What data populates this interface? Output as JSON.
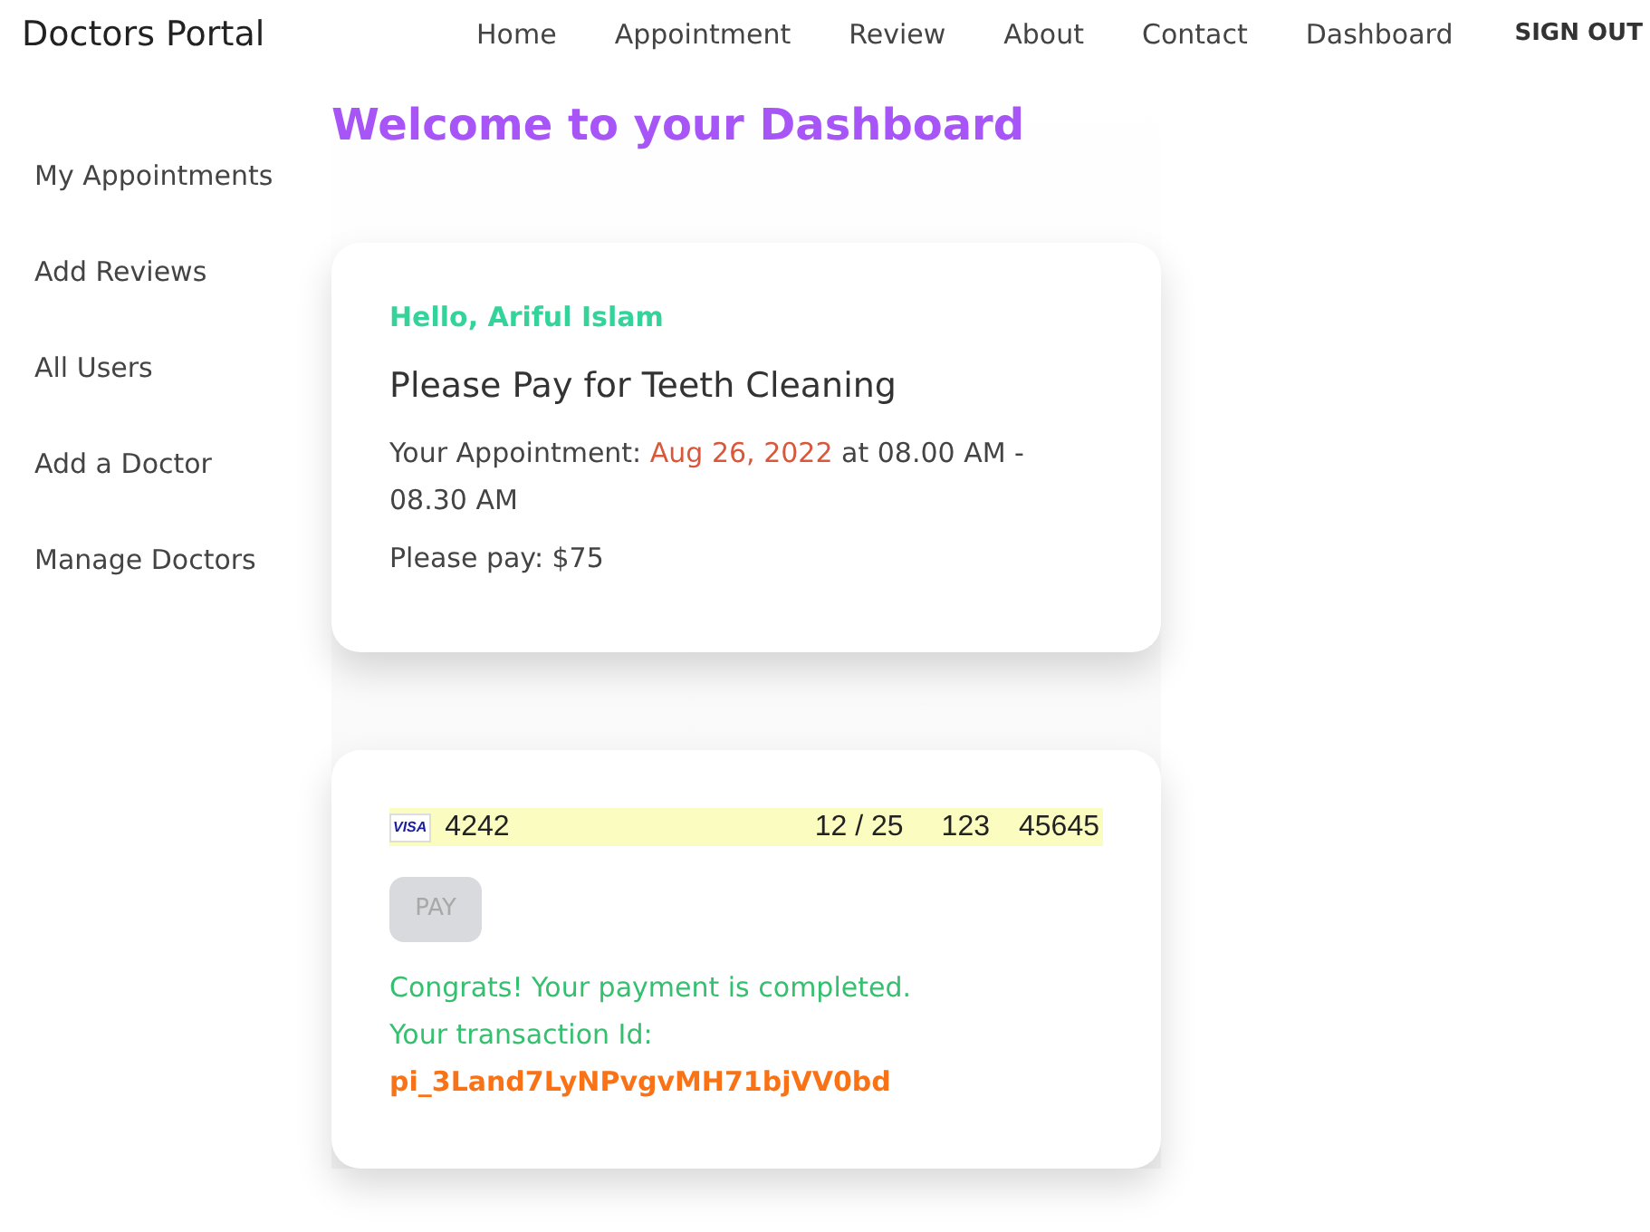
{
  "navbar": {
    "brand": "Doctors Portal",
    "links": [
      "Home",
      "Appointment",
      "Review",
      "About",
      "Contact",
      "Dashboard"
    ],
    "sign_out": "SIGN OUT"
  },
  "sidebar": {
    "items": [
      "My Appointments",
      "Add Reviews",
      "All Users",
      "Add a Doctor",
      "Manage Doctors"
    ]
  },
  "heading": "Welcome to your Dashboard",
  "appointment_card": {
    "greeting": "Hello, Ariful Islam",
    "title": "Please Pay for Teeth Cleaning",
    "appointment_label": "Your Appointment:",
    "date": "Aug 26, 2022",
    "time": "at 08.00 AM - 08.30 AM",
    "price": "Please pay: $75"
  },
  "payment_card": {
    "card_brand": "VISA",
    "card_number": "4242",
    "expiry": "12 / 25",
    "cvc": "123",
    "zip": "45645",
    "pay_button": {
      "label": "PAY",
      "disabled": true
    },
    "success": "Congrats! Your payment is completed.",
    "transaction_label": "Your transaction Id:",
    "transaction_id": "pi_3Land7LyNPvgvMH71bjVV0bd"
  }
}
